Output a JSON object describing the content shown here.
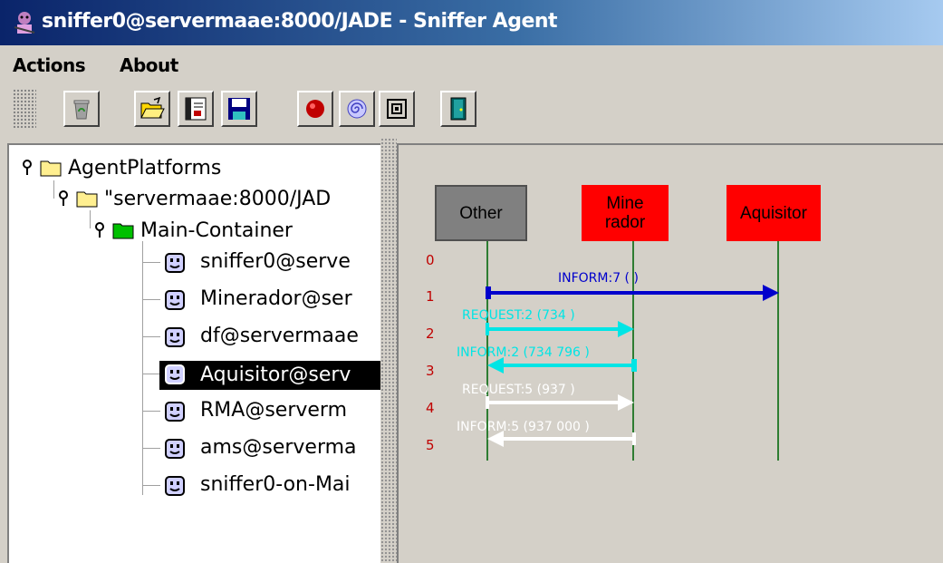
{
  "window": {
    "title": "sniffer0@servermaae:8000/JADE - Sniffer Agent",
    "title_icon": "sniffer-agent-icon"
  },
  "menu": [
    "Actions",
    "About"
  ],
  "toolbar": {
    "buttons": [
      {
        "name": "clear-canvas-button",
        "icon": "recycle-bin-icon"
      },
      {
        "name": "open-button",
        "icon": "folder-open-icon"
      },
      {
        "name": "display-log-button",
        "icon": "message-log-icon"
      },
      {
        "name": "save-button",
        "icon": "floppy-disk-icon"
      },
      {
        "name": "record-button",
        "icon": "red-record-icon"
      },
      {
        "name": "sniff-button",
        "icon": "spiral-icon"
      },
      {
        "name": "stop-sniff-button",
        "icon": "nested-squares-icon"
      },
      {
        "name": "exit-button",
        "icon": "door-exit-icon"
      }
    ]
  },
  "tree": {
    "root": "AgentPlatforms",
    "platform": "\"servermaae:8000/JAD",
    "container": "Main-Container",
    "agents": [
      {
        "label": "sniffer0@serve",
        "selected": false
      },
      {
        "label": "Minerador@ser",
        "selected": false
      },
      {
        "label": "df@servermaae",
        "selected": false
      },
      {
        "label": "Aquisitor@serv",
        "selected": true
      },
      {
        "label": "RMA@serverm",
        "selected": false
      },
      {
        "label": "ams@serverma",
        "selected": false
      },
      {
        "label": "sniffer0-on-Mai",
        "selected": false
      }
    ]
  },
  "sniffer": {
    "agents": [
      {
        "label": "Other",
        "color": "#808080"
      },
      {
        "label": "Mine rador",
        "color": "#ff0000"
      },
      {
        "label": "Aquisitor",
        "color": "#ff0000"
      }
    ],
    "row_numbers": [
      "0",
      "1",
      "2",
      "3",
      "4",
      "5"
    ],
    "messages": [
      {
        "label": "INFORM:7 (      )",
        "from": 0,
        "to": 2,
        "color": "#0000cc"
      },
      {
        "label": "REQUEST:2 (734       )",
        "from": 0,
        "to": 1,
        "color": "#00e5e5"
      },
      {
        "label": "INFORM:2 (734  796     )",
        "from": 1,
        "to": 0,
        "color": "#00e5e5"
      },
      {
        "label": "REQUEST:5 (937       )",
        "from": 0,
        "to": 1,
        "color": "#ffffff"
      },
      {
        "label": "INFORM:5 (937  000     )",
        "from": 1,
        "to": 0,
        "color": "#ffffff"
      }
    ],
    "lifeline_color": "#2e7d32"
  }
}
